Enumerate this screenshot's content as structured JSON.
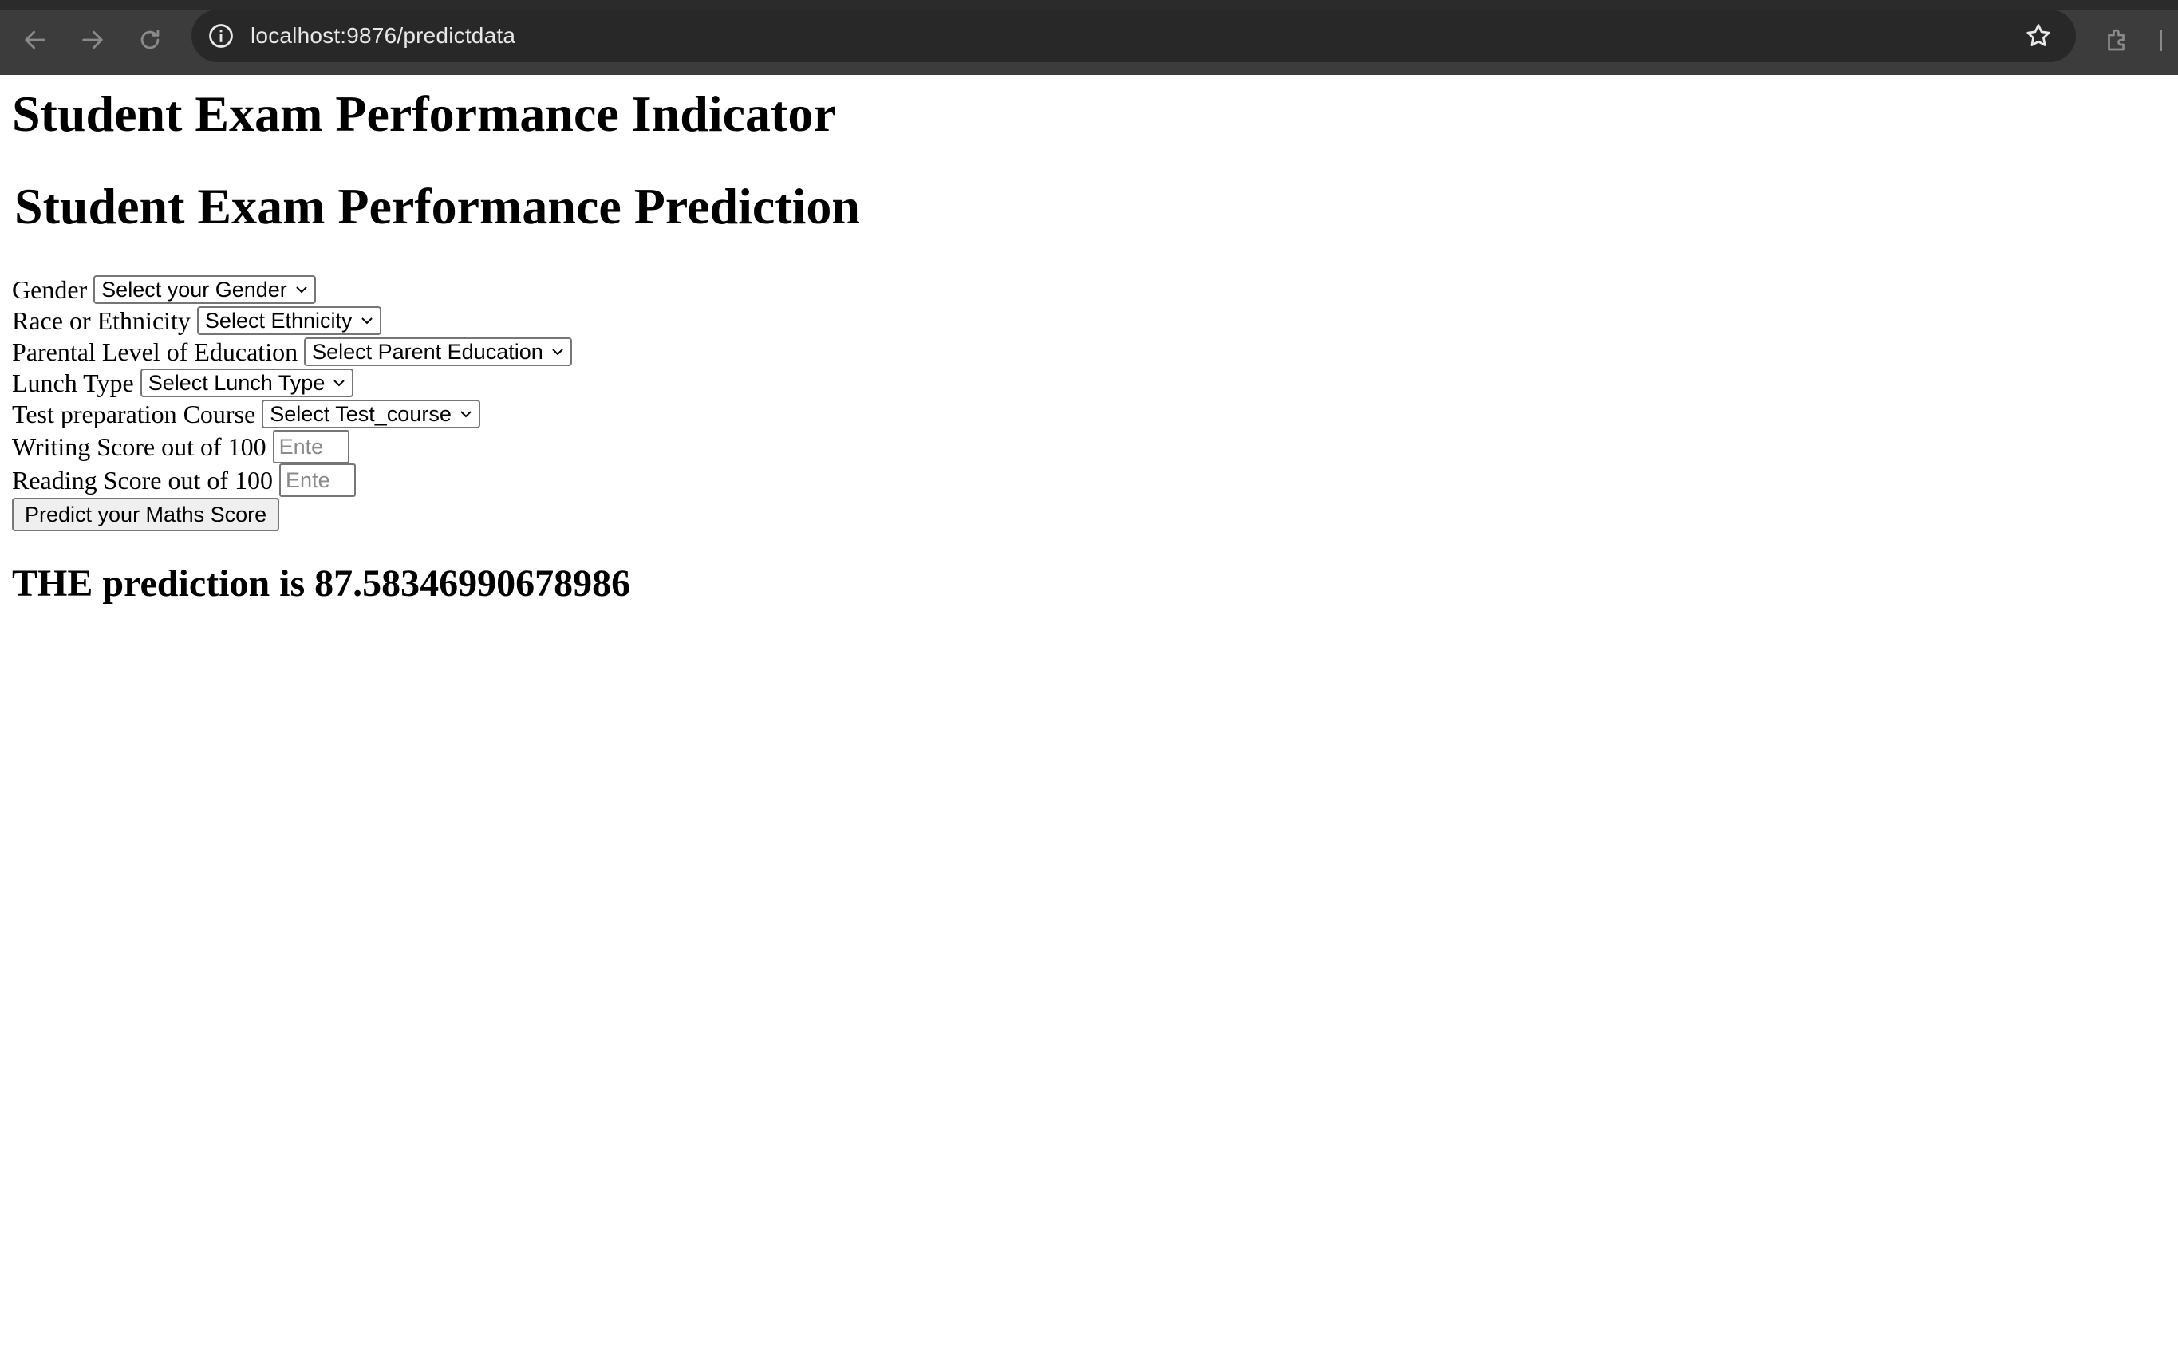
{
  "browser": {
    "url": "localhost:9876/predictdata",
    "icons": {
      "back": "back-arrow-icon",
      "forward": "forward-arrow-icon",
      "reload": "reload-icon",
      "site_info": "info-icon",
      "bookmark": "star-icon",
      "extensions": "puzzle-icon"
    }
  },
  "page": {
    "title": "Student Exam Performance Indicator",
    "subtitle": "Student Exam Performance Prediction",
    "form": {
      "gender": {
        "label": "Gender",
        "selected": "Select your Gender"
      },
      "ethnicity": {
        "label": "Race or Ethnicity",
        "selected": "Select Ethnicity"
      },
      "parent_education": {
        "label": "Parental Level of Education",
        "selected": "Select Parent Education"
      },
      "lunch": {
        "label": "Lunch Type",
        "selected": "Select Lunch Type"
      },
      "test_course": {
        "label": "Test preparation Course",
        "selected": "Select Test_course"
      },
      "writing_score": {
        "label": "Writing Score out of 100",
        "placeholder": "Ente"
      },
      "reading_score": {
        "label": "Reading Score out of 100",
        "placeholder": "Ente"
      },
      "submit_label": "Predict your Maths Score"
    },
    "result": "THE prediction is 87.58346990678986"
  }
}
